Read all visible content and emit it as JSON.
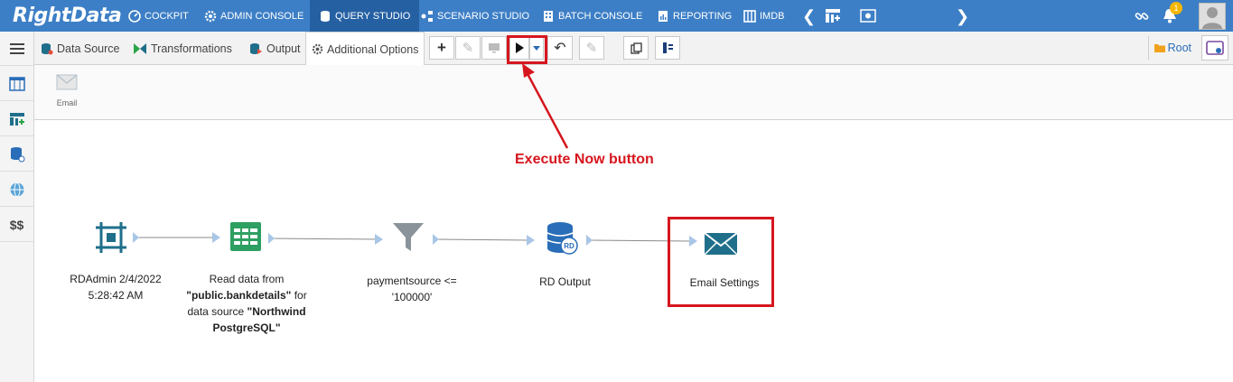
{
  "app": {
    "logo": "RightData"
  },
  "topnav": {
    "items": [
      {
        "label": "COCKPIT",
        "icon": "gauge-icon"
      },
      {
        "label": "ADMIN CONSOLE",
        "icon": "gear-icon"
      },
      {
        "label": "QUERY STUDIO",
        "icon": "database-icon"
      },
      {
        "label": "SCENARIO STUDIO",
        "icon": "workflow-icon"
      },
      {
        "label": "BATCH CONSOLE",
        "icon": "building-icon"
      },
      {
        "label": "REPORTING",
        "icon": "report-icon"
      },
      {
        "label": "IMDB",
        "icon": "columns-icon"
      }
    ],
    "notification_count": "1"
  },
  "tabs": {
    "data_source": "Data Source",
    "transformations": "Transformations",
    "output": "Output",
    "additional_options": "Additional Options"
  },
  "toolbar": {
    "root_label": "Root"
  },
  "subbar": {
    "email_label": "Email"
  },
  "canvas": {
    "nodes": [
      {
        "line1": "RDAdmin 2/4/2022",
        "line2": "5:28:42 AM"
      },
      {
        "line1": "Read data from",
        "line2": "\"public.bankdetails\"",
        "line2b": " for",
        "line3": "data source ",
        "line3b": "\"Northwind",
        "line4": "PostgreSQL\""
      },
      {
        "line1": "paymentsource <=",
        "line2": "'100000'"
      },
      {
        "line1": "RD Output"
      },
      {
        "line1": "Email Settings"
      }
    ]
  },
  "annotation": {
    "text": "Execute Now button"
  },
  "colors": {
    "topbar": "#3d7fc6",
    "accent_red": "#d6161e",
    "icon_teal": "#1f6f8b"
  }
}
